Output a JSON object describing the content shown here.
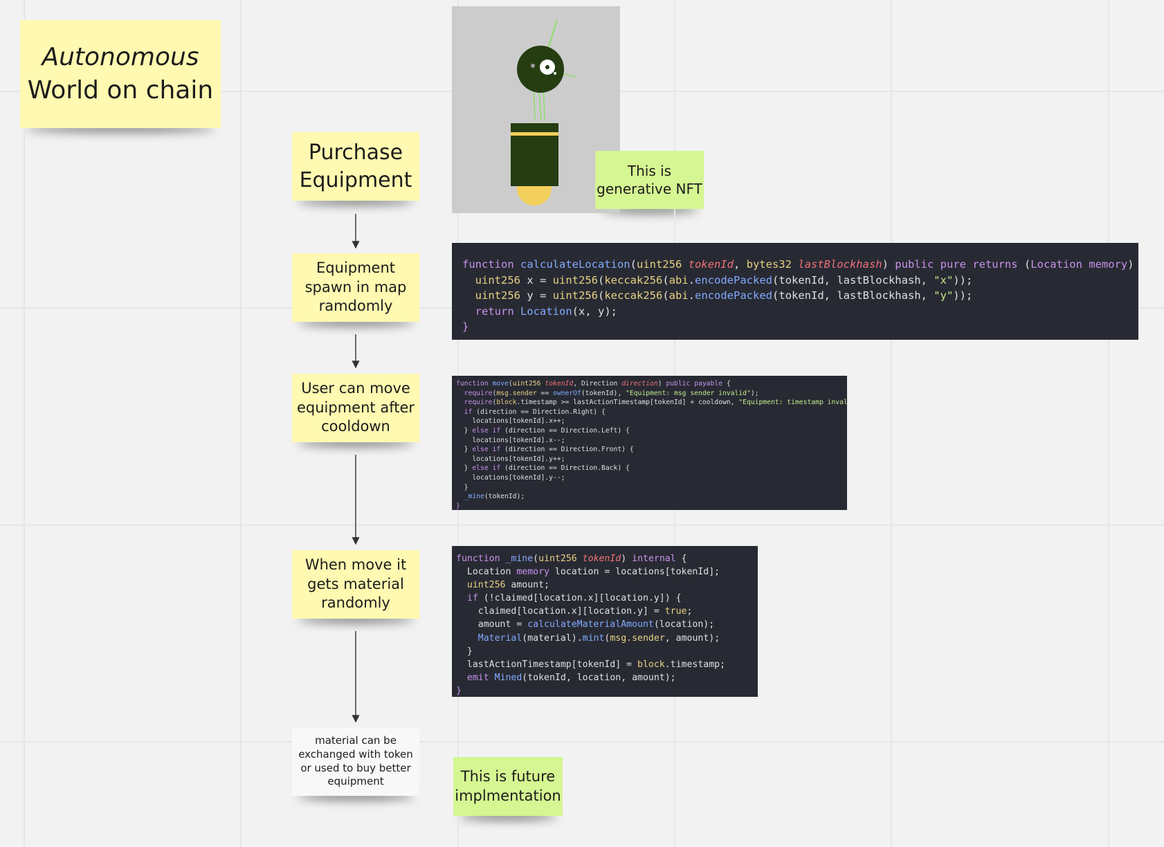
{
  "title_note": {
    "line1": "Autonomous",
    "line2": "World on chain"
  },
  "flow_steps": [
    {
      "text": "Purchase Equipment"
    },
    {
      "text": "Equipment spawn in map ramdomly"
    },
    {
      "text": "User can move equipment after cooldown"
    },
    {
      "text": "When move it gets material randomly"
    },
    {
      "text": "material can be exchanged with token or used to buy better equipment"
    }
  ],
  "side_notes": {
    "nft": "This is generative NFT",
    "future": "This is future implmentation"
  },
  "colors": {
    "canvas": "#f2f2f2",
    "sticky_yellow": "#fff9b1",
    "sticky_green": "#d5f692",
    "code_bg": "#282a33",
    "nft_bg": "#cccccc",
    "nft_dark": "#253d11",
    "nft_yellow": "#f3cf5b",
    "nft_line": "#8ede6f"
  },
  "code_blocks": [
    [
      [
        [
          "function ",
          "kw"
        ],
        [
          "calculateLocation",
          "fn"
        ],
        [
          "(",
          ""
        ],
        [
          "uint256 ",
          "ty"
        ],
        [
          "tokenId",
          "par"
        ],
        [
          ", ",
          ""
        ],
        [
          "bytes32 ",
          "ty"
        ],
        [
          "lastBlockhash",
          "par"
        ],
        [
          ") ",
          ""
        ],
        [
          "public pure returns ",
          "kw"
        ],
        [
          "(",
          ""
        ],
        [
          "Location memory",
          "kw"
        ],
        [
          ") {",
          ""
        ]
      ],
      [
        [
          "  ",
          ""
        ],
        [
          "uint256 ",
          "ty"
        ],
        [
          "x = ",
          ""
        ],
        [
          "uint256",
          "ty"
        ],
        [
          "(",
          ""
        ],
        [
          "keccak256",
          "ty"
        ],
        [
          "(",
          ""
        ],
        [
          "abi",
          "ty"
        ],
        [
          ".",
          ""
        ],
        [
          "encodePacked",
          "fn"
        ],
        [
          "(tokenId, lastBlockhash, ",
          ""
        ],
        [
          "\"x\"",
          "str"
        ],
        [
          "));",
          ""
        ]
      ],
      [
        [
          "  ",
          ""
        ],
        [
          "uint256 ",
          "ty"
        ],
        [
          "y = ",
          ""
        ],
        [
          "uint256",
          "ty"
        ],
        [
          "(",
          ""
        ],
        [
          "keccak256",
          "ty"
        ],
        [
          "(",
          ""
        ],
        [
          "abi",
          "ty"
        ],
        [
          ".",
          ""
        ],
        [
          "encodePacked",
          "fn"
        ],
        [
          "(tokenId, lastBlockhash, ",
          ""
        ],
        [
          "\"y\"",
          "str"
        ],
        [
          "));",
          ""
        ]
      ],
      [
        [
          "  ",
          ""
        ],
        [
          "return ",
          "kw"
        ],
        [
          "Location",
          "fn"
        ],
        [
          "(x, y);",
          ""
        ]
      ],
      [
        [
          "}",
          "br"
        ]
      ]
    ],
    [
      [
        [
          "function ",
          "kw"
        ],
        [
          "move",
          "fn"
        ],
        [
          "(",
          ""
        ],
        [
          "uint256 ",
          "ty"
        ],
        [
          "tokenId",
          "par"
        ],
        [
          ", Direction ",
          ""
        ],
        [
          "direction",
          "par"
        ],
        [
          ") ",
          ""
        ],
        [
          "public payable ",
          "kw"
        ],
        [
          "{",
          ""
        ]
      ],
      [
        [
          "  ",
          ""
        ],
        [
          "require",
          "kw"
        ],
        [
          "(",
          ""
        ],
        [
          "msg.sender",
          "ty"
        ],
        [
          " == ",
          ""
        ],
        [
          "ownerOf",
          "fn"
        ],
        [
          "(tokenId), ",
          ""
        ],
        [
          "\"Equipment: msg sender invalid\"",
          "str"
        ],
        [
          ");",
          ""
        ]
      ],
      [
        [
          "  ",
          ""
        ],
        [
          "require",
          "kw"
        ],
        [
          "(",
          ""
        ],
        [
          "block",
          "ty"
        ],
        [
          ".timestamp >= lastActionTimestamp[tokenId] + cooldown, ",
          ""
        ],
        [
          "\"Equipment: timestamp invalid\"",
          "str"
        ],
        [
          ");",
          ""
        ]
      ],
      [
        [
          "  ",
          ""
        ],
        [
          "if ",
          "kw"
        ],
        [
          "(direction == Direction.Right) {",
          ""
        ]
      ],
      [
        [
          "    locations[tokenId].x++;",
          ""
        ]
      ],
      [
        [
          "  } ",
          ""
        ],
        [
          "else if ",
          "kw"
        ],
        [
          "(direction == Direction.Left) {",
          ""
        ]
      ],
      [
        [
          "    locations[tokenId].x--;",
          ""
        ]
      ],
      [
        [
          "  } ",
          ""
        ],
        [
          "else if ",
          "kw"
        ],
        [
          "(direction == Direction.Front) {",
          ""
        ]
      ],
      [
        [
          "    locations[tokenId].y++;",
          ""
        ]
      ],
      [
        [
          "  } ",
          ""
        ],
        [
          "else if ",
          "kw"
        ],
        [
          "(direction == Direction.Back) {",
          ""
        ]
      ],
      [
        [
          "    locations[tokenId].y--;",
          ""
        ]
      ],
      [
        [
          "  }",
          ""
        ]
      ],
      [
        [
          "  ",
          ""
        ],
        [
          "_mine",
          "fn"
        ],
        [
          "(tokenId);",
          ""
        ]
      ],
      [
        [
          "}",
          "br"
        ]
      ]
    ],
    [
      [
        [
          "function ",
          "kw"
        ],
        [
          "_mine",
          "fn"
        ],
        [
          "(",
          ""
        ],
        [
          "uint256 ",
          "ty"
        ],
        [
          "tokenId",
          "par"
        ],
        [
          ") ",
          ""
        ],
        [
          "internal ",
          "kw"
        ],
        [
          "{",
          ""
        ]
      ],
      [
        [
          "  Location ",
          ""
        ],
        [
          "memory ",
          "kw"
        ],
        [
          "location = locations[tokenId];",
          ""
        ]
      ],
      [
        [
          "  ",
          ""
        ],
        [
          "uint256 ",
          "ty"
        ],
        [
          "amount;",
          ""
        ]
      ],
      [
        [
          "  ",
          ""
        ],
        [
          "if ",
          "kw"
        ],
        [
          "(!claimed[location.x][location.y]) {",
          ""
        ]
      ],
      [
        [
          "    claimed[location.x][location.y] = ",
          ""
        ],
        [
          "true",
          "ty"
        ],
        [
          ";",
          ""
        ]
      ],
      [
        [
          "    amount = ",
          ""
        ],
        [
          "calculateMaterialAmount",
          "fn"
        ],
        [
          "(location);",
          ""
        ]
      ],
      [
        [
          "    ",
          ""
        ],
        [
          "Material",
          "fn"
        ],
        [
          "(material).",
          ""
        ],
        [
          "mint",
          "fn"
        ],
        [
          "(",
          ""
        ],
        [
          "msg.sender",
          "ty"
        ],
        [
          ", amount);",
          ""
        ]
      ],
      [
        [
          "  }",
          ""
        ]
      ],
      [
        [
          "  lastActionTimestamp[tokenId] = ",
          ""
        ],
        [
          "block",
          "ty"
        ],
        [
          ".timestamp;",
          ""
        ]
      ],
      [
        [
          "  ",
          ""
        ],
        [
          "emit ",
          "kw"
        ],
        [
          "Mined",
          "fn"
        ],
        [
          "(tokenId, location, amount);",
          ""
        ]
      ],
      [
        [
          "}",
          "br"
        ]
      ]
    ]
  ]
}
